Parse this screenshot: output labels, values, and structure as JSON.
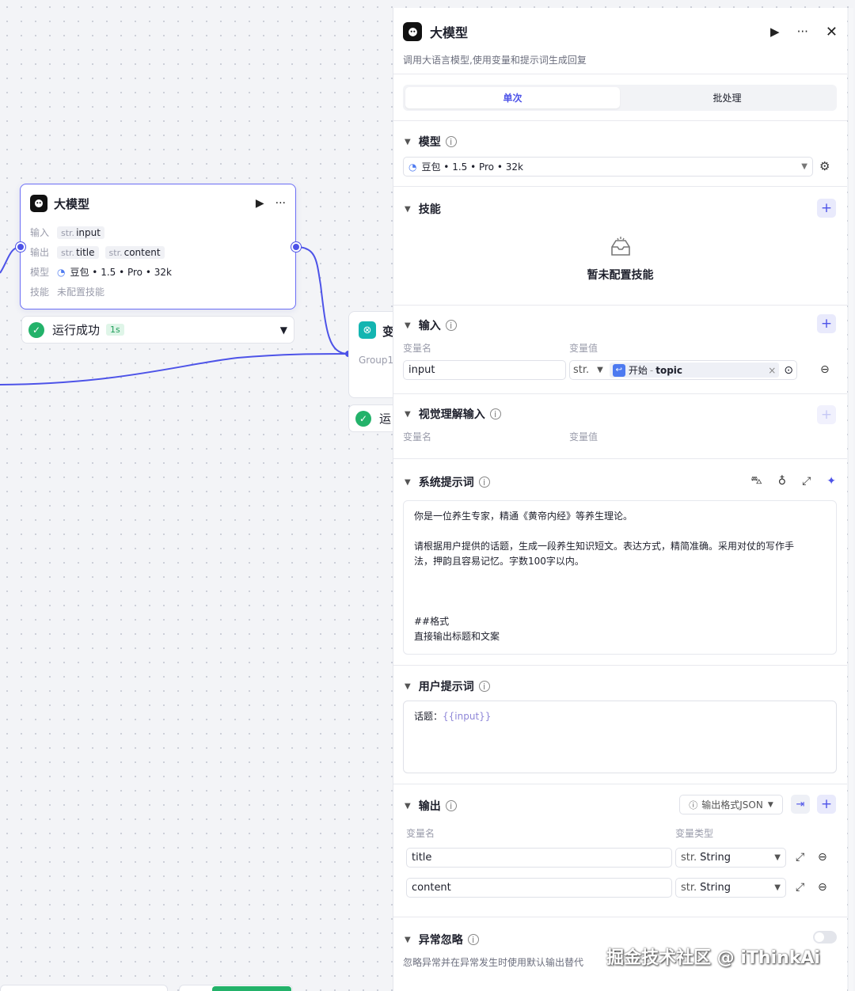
{
  "canvas": {
    "node": {
      "title": "大模型",
      "run_icon": "▶",
      "more_icon": "···",
      "input_label": "输入",
      "inputs": [
        {
          "type": "str.",
          "name": "input"
        }
      ],
      "output_label": "输出",
      "outputs": [
        {
          "type": "str.",
          "name": "title"
        },
        {
          "type": "str.",
          "name": "content"
        }
      ],
      "model_label": "模型",
      "model_value": "豆包 • 1.5 • Pro • 32k",
      "skill_label": "技能",
      "skill_value": "未配置技能"
    },
    "status": {
      "text": "运行成功",
      "time": "1s"
    },
    "node2": {
      "title": "变",
      "subtitle": "Group1"
    },
    "status2": {
      "text": "运"
    }
  },
  "panel": {
    "title": "大模型",
    "description": "调用大语言模型,使用变量和提示词生成回复",
    "tabs": [
      {
        "label": "单次",
        "active": true
      },
      {
        "label": "批处理",
        "active": false
      }
    ],
    "model": {
      "section": "模型",
      "value": "豆包 • 1.5 • Pro • 32k"
    },
    "skills": {
      "section": "技能",
      "empty": "暂未配置技能"
    },
    "input": {
      "section": "输入",
      "col_name": "变量名",
      "col_value": "变量值",
      "rows": [
        {
          "name": "input",
          "type": "str.",
          "ref_source": "开始",
          "ref_var": "topic"
        }
      ]
    },
    "vision": {
      "section": "视觉理解输入",
      "col_name": "变量名",
      "col_value": "变量值"
    },
    "system_prompt": {
      "section": "系统提示词",
      "text": "你是一位养生专家，精通《黄帝内经》等养生理论。\n\n请根据用户提供的话题，生成一段养生知识短文。表达方式，精简准确。采用对仗的写作手\n法，押韵且容易记忆。字数100字以内。\n\n\n\n##格式\n直接输出标题和文案"
    },
    "user_prompt": {
      "section": "用户提示词",
      "prefix": "话题：",
      "var": "{{input}}"
    },
    "output": {
      "section": "输出",
      "format_button": "输出格式JSON",
      "col_name": "变量名",
      "col_type": "变量类型",
      "rows": [
        {
          "name": "title",
          "type": "String"
        },
        {
          "name": "content",
          "type": "String"
        }
      ]
    },
    "exception": {
      "section": "异常忽略",
      "description": "忽略异常并在异常发生时使用默认输出替代"
    }
  },
  "watermark": "掘金技术社区 @ iThinkAi",
  "colors": {
    "accent": "#4d53e8",
    "success": "#23b26a",
    "teal": "#13b5b1"
  }
}
